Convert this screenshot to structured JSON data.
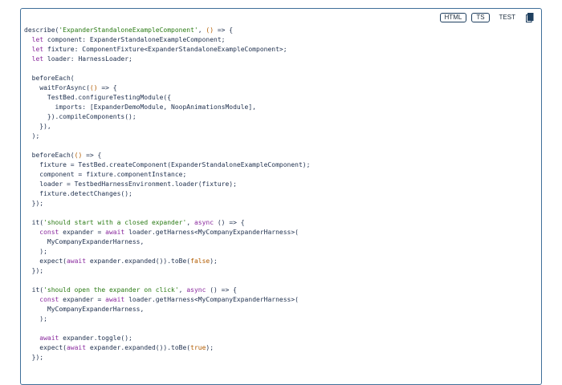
{
  "toolbar": {
    "tabs": [
      "HTML",
      "TS",
      "TEST"
    ],
    "active_tab": "TEST",
    "copy_icon": "copy-icon"
  },
  "colors": {
    "border": "#3f6f99",
    "text": "#1e2f4d",
    "string": "#2a7a14",
    "keyword": "#8a2a9e",
    "literal": "#b25c00"
  },
  "code_lines": [
    [
      [
        "n",
        "describe("
      ],
      [
        "s",
        "'ExpanderStandaloneExampleComponent'"
      ],
      [
        "n",
        ", "
      ],
      [
        "b",
        "()"
      ],
      [
        "n",
        " => {"
      ]
    ],
    [
      [
        "n",
        "  "
      ],
      [
        "k",
        "let"
      ],
      [
        "n",
        " component: ExpanderStandaloneExampleComponent;"
      ]
    ],
    [
      [
        "n",
        "  "
      ],
      [
        "k",
        "let"
      ],
      [
        "n",
        " fixture: ComponentFixture<ExpanderStandaloneExampleComponent>;"
      ]
    ],
    [
      [
        "n",
        "  "
      ],
      [
        "k",
        "let"
      ],
      [
        "n",
        " loader: HarnessLoader;"
      ]
    ],
    [
      [
        "n",
        ""
      ]
    ],
    [
      [
        "n",
        "  beforeEach("
      ]
    ],
    [
      [
        "n",
        "    waitForAsync("
      ],
      [
        "b",
        "()"
      ],
      [
        "n",
        " => {"
      ]
    ],
    [
      [
        "n",
        "      TestBed.configureTestingModule({"
      ]
    ],
    [
      [
        "n",
        "        imports: [ExpanderDemoModule, NoopAnimationsModule],"
      ]
    ],
    [
      [
        "n",
        "      }).compileComponents();"
      ]
    ],
    [
      [
        "n",
        "    }),"
      ]
    ],
    [
      [
        "n",
        "  );"
      ]
    ],
    [
      [
        "n",
        ""
      ]
    ],
    [
      [
        "n",
        "  beforeEach("
      ],
      [
        "b",
        "()"
      ],
      [
        "n",
        " => {"
      ]
    ],
    [
      [
        "n",
        "    fixture = TestBed.createComponent(ExpanderStandaloneExampleComponent);"
      ]
    ],
    [
      [
        "n",
        "    component = fixture.componentInstance;"
      ]
    ],
    [
      [
        "n",
        "    loader = TestbedHarnessEnvironment.loader(fixture);"
      ]
    ],
    [
      [
        "n",
        "    fixture.detectChanges();"
      ]
    ],
    [
      [
        "n",
        "  });"
      ]
    ],
    [
      [
        "n",
        ""
      ]
    ],
    [
      [
        "n",
        "  it("
      ],
      [
        "s",
        "'should start with a closed expander'"
      ],
      [
        "n",
        ", "
      ],
      [
        "k",
        "async"
      ],
      [
        "n",
        " () => {"
      ]
    ],
    [
      [
        "n",
        "    "
      ],
      [
        "k",
        "const"
      ],
      [
        "n",
        " expander = "
      ],
      [
        "k",
        "await"
      ],
      [
        "n",
        " loader.getHarness<MyCompanyExpanderHarness>("
      ]
    ],
    [
      [
        "n",
        "      MyCompanyExpanderHarness,"
      ]
    ],
    [
      [
        "n",
        "    );"
      ]
    ],
    [
      [
        "n",
        "    expect("
      ],
      [
        "k",
        "await"
      ],
      [
        "n",
        " expander.expanded()).toBe("
      ],
      [
        "b",
        "false"
      ],
      [
        "n",
        ");"
      ]
    ],
    [
      [
        "n",
        "  });"
      ]
    ],
    [
      [
        "n",
        ""
      ]
    ],
    [
      [
        "n",
        "  it("
      ],
      [
        "s",
        "'should open the expander on click'"
      ],
      [
        "n",
        ", "
      ],
      [
        "k",
        "async"
      ],
      [
        "n",
        " () => {"
      ]
    ],
    [
      [
        "n",
        "    "
      ],
      [
        "k",
        "const"
      ],
      [
        "n",
        " expander = "
      ],
      [
        "k",
        "await"
      ],
      [
        "n",
        " loader.getHarness<MyCompanyExpanderHarness>("
      ]
    ],
    [
      [
        "n",
        "      MyCompanyExpanderHarness,"
      ]
    ],
    [
      [
        "n",
        "    );"
      ]
    ],
    [
      [
        "n",
        ""
      ]
    ],
    [
      [
        "n",
        "    "
      ],
      [
        "k",
        "await"
      ],
      [
        "n",
        " expander.toggle();"
      ]
    ],
    [
      [
        "n",
        "    expect("
      ],
      [
        "k",
        "await"
      ],
      [
        "n",
        " expander.expanded()).toBe("
      ],
      [
        "b",
        "true"
      ],
      [
        "n",
        ");"
      ]
    ],
    [
      [
        "n",
        "  });"
      ]
    ]
  ]
}
